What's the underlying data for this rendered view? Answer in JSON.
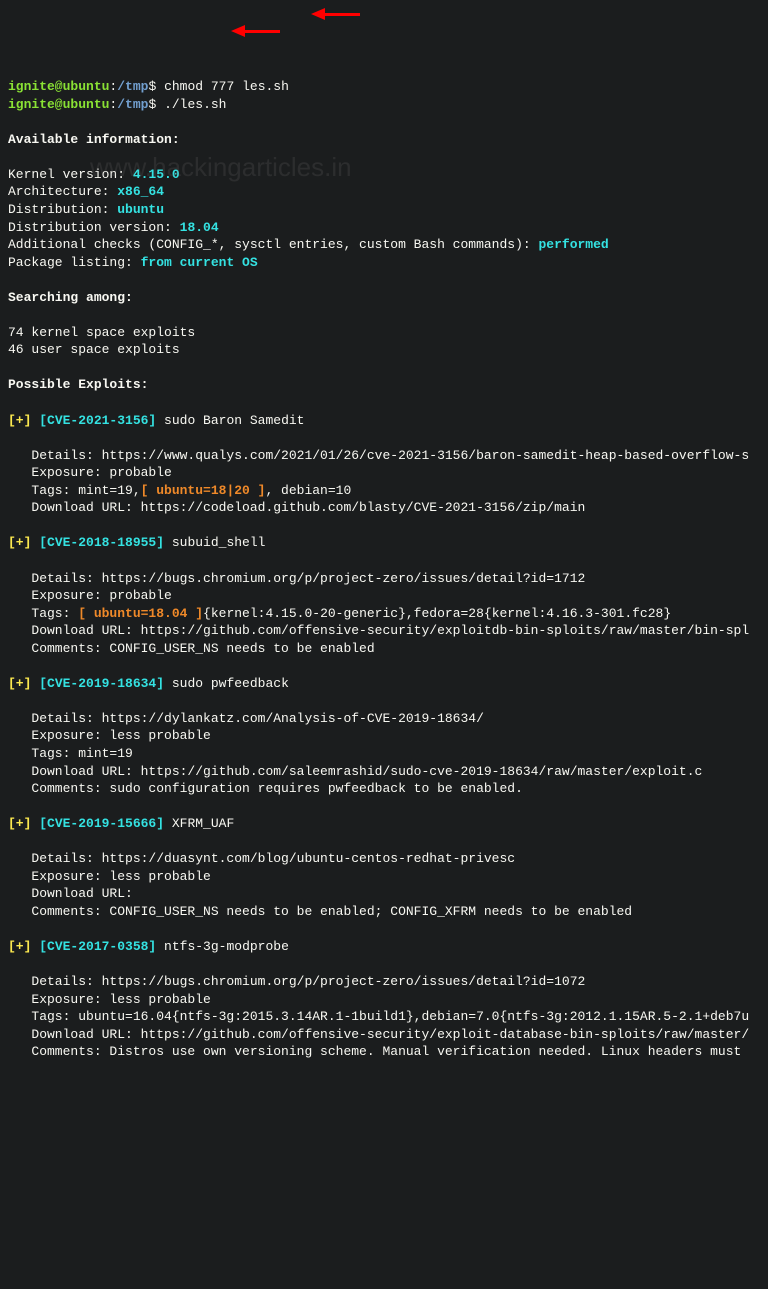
{
  "prompt": {
    "user": "ignite@ubuntu",
    "sep": ":",
    "path": "/tmp",
    "dollar": "$"
  },
  "commands": {
    "cmd1": "chmod 777 les.sh",
    "cmd2": "./les.sh"
  },
  "watermark": "www.hackingarticles.in",
  "section_available": "Available information:",
  "kernel_label": "Kernel version: ",
  "kernel_value": "4.15.0",
  "arch_label": "Architecture: ",
  "arch_value": "x86_64",
  "dist_label": "Distribution: ",
  "dist_value": "ubuntu",
  "distver_label": "Distribution version: ",
  "distver_value": "18.04",
  "addchecks_label": "Additional checks (CONFIG_*, sysctl entries, custom Bash commands): ",
  "addchecks_value": "performed",
  "pkg_label": "Package listing: ",
  "pkg_value": "from current OS",
  "section_searching": "Searching among:",
  "search_kernel": "74 kernel space exploits",
  "search_user": "46 user space exploits",
  "section_exploits": "Possible Exploits:",
  "ex1": {
    "plus": "[+] ",
    "cve": "[CVE-2021-3156]",
    "name": " sudo Baron Samedit",
    "details": "   Details: https://www.qualys.com/2021/01/26/cve-2021-3156/baron-samedit-heap-based-overflow-s",
    "exposure": "   Exposure: probable",
    "tags_pre": "   Tags: mint=19,",
    "tags_hl": "[ ubuntu=18|20 ]",
    "tags_post": ", debian=10",
    "download": "   Download URL: https://codeload.github.com/blasty/CVE-2021-3156/zip/main"
  },
  "ex2": {
    "plus": "[+] ",
    "cve": "[CVE-2018-18955]",
    "name": " subuid_shell",
    "details": "   Details: https://bugs.chromium.org/p/project-zero/issues/detail?id=1712",
    "exposure": "   Exposure: probable",
    "tags_pre": "   Tags: ",
    "tags_hl": "[ ubuntu=18.04 ]",
    "tags_post": "{kernel:4.15.0-20-generic},fedora=28{kernel:4.16.3-301.fc28}",
    "download": "   Download URL: https://github.com/offensive-security/exploitdb-bin-sploits/raw/master/bin-spl",
    "comments": "   Comments: CONFIG_USER_NS needs to be enabled"
  },
  "ex3": {
    "plus": "[+] ",
    "cve": "[CVE-2019-18634]",
    "name": " sudo pwfeedback",
    "details": "   Details: https://dylankatz.com/Analysis-of-CVE-2019-18634/",
    "exposure": "   Exposure: less probable",
    "tags": "   Tags: mint=19",
    "download": "   Download URL: https://github.com/saleemrashid/sudo-cve-2019-18634/raw/master/exploit.c",
    "comments": "   Comments: sudo configuration requires pwfeedback to be enabled."
  },
  "ex4": {
    "plus": "[+] ",
    "cve": "[CVE-2019-15666]",
    "name": " XFRM_UAF",
    "details": "   Details: https://duasynt.com/blog/ubuntu-centos-redhat-privesc",
    "exposure": "   Exposure: less probable",
    "download": "   Download URL: ",
    "comments": "   Comments: CONFIG_USER_NS needs to be enabled; CONFIG_XFRM needs to be enabled"
  },
  "ex5": {
    "plus": "[+] ",
    "cve": "[CVE-2017-0358]",
    "name": " ntfs-3g-modprobe",
    "details": "   Details: https://bugs.chromium.org/p/project-zero/issues/detail?id=1072",
    "exposure": "   Exposure: less probable",
    "tags": "   Tags: ubuntu=16.04{ntfs-3g:2015.3.14AR.1-1build1},debian=7.0{ntfs-3g:2012.1.15AR.5-2.1+deb7u",
    "download": "   Download URL: https://github.com/offensive-security/exploit-database-bin-sploits/raw/master/",
    "comments": "   Comments: Distros use own versioning scheme. Manual verification needed. Linux headers must "
  }
}
